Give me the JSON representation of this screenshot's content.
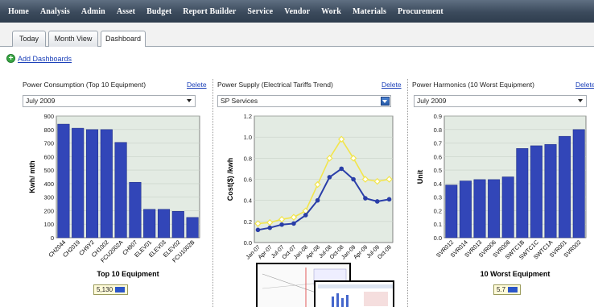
{
  "nav": [
    "Home",
    "Analysis",
    "Admin",
    "Asset",
    "Budget",
    "Report Builder",
    "Service",
    "Vendor",
    "Work",
    "Materials",
    "Procurement"
  ],
  "tabs": [
    "Today",
    "Month View",
    "Dashboard"
  ],
  "add_dashboards": "Add Dashboards",
  "panels": [
    {
      "title": "Power Consumption (Top 10 Equipment)",
      "delete_label": "Delete",
      "select_value": "July 2009",
      "badge_value": "5,130"
    },
    {
      "title": "Power Supply (Electrical Tariffs Trend)",
      "delete_label": "Delete",
      "select_value": "SP Services"
    },
    {
      "title": "Power Harmonics (10 Worst Equipment)",
      "delete_label": "Delete",
      "select_value": "July 2009",
      "badge_value": "5.7"
    }
  ],
  "colors": {
    "bar": "#3246b8",
    "line_series": "#2a3ea8",
    "yellow_series": "#f2e54c",
    "plot_bg": "#e3ebe3",
    "nav_bg": "#3b4a5c"
  },
  "chart_data": [
    {
      "type": "bar",
      "title": "Power Consumption (Top 10 Equipment)",
      "xlabel": "Top 10 Equipment",
      "ylabel": "Kwh/ mth",
      "ylim": [
        0,
        900
      ],
      "yticks": [
        0,
        100,
        200,
        300,
        400,
        500,
        600,
        700,
        800,
        900
      ],
      "categories": [
        "CH2044",
        "CH2019",
        "CH9Y2",
        "CH1002",
        "FCU2002A",
        "CH907",
        "ELEV01",
        "ELEV03",
        "ELEV02",
        "FCU1002B"
      ],
      "values": [
        840,
        810,
        800,
        800,
        705,
        410,
        210,
        210,
        195,
        150
      ]
    },
    {
      "type": "line",
      "title": "Power Supply (Electrical Tariffs Trend)",
      "xlabel": "",
      "ylabel": "Cost($) /kwh",
      "ylim": [
        0,
        1.2
      ],
      "yticks": [
        0,
        0.2,
        0.4,
        0.6,
        0.8,
        1.0,
        1.2
      ],
      "ytick_labels": [
        "0.0",
        "0.2",
        "0.4",
        "0.6",
        "0.8",
        "1.0",
        "1.2"
      ],
      "x": [
        "Jan-07",
        "Apr-07",
        "Jul-07",
        "Oct-07",
        "Jan-08",
        "Apr-08",
        "Jul-08",
        "Oct-08",
        "Jan-09",
        "Apr-09",
        "Jul-09",
        "Oct-09"
      ],
      "series": [
        {
          "values": [
            0.18,
            0.19,
            0.22,
            0.24,
            0.3,
            0.55,
            0.8,
            0.98,
            0.8,
            0.6,
            0.58,
            0.6
          ]
        },
        {
          "values": [
            0.12,
            0.14,
            0.17,
            0.18,
            0.26,
            0.4,
            0.62,
            0.7,
            0.6,
            0.42,
            0.39,
            0.41
          ]
        }
      ]
    },
    {
      "type": "bar",
      "title": "Power Harmonics (10 Worst Equipment)",
      "xlabel": "10 Worst Equipment",
      "ylabel": "Unit",
      "ylim": [
        0,
        0.9
      ],
      "yticks": [
        0,
        0.1,
        0.2,
        0.3,
        0.4,
        0.5,
        0.6,
        0.7,
        0.8,
        0.9
      ],
      "ytick_labels": [
        "0.0",
        "0.1",
        "0.2",
        "0.3",
        "0.4",
        "0.5",
        "0.6",
        "0.7",
        "0.8",
        "0.9"
      ],
      "categories": [
        "SVR012",
        "SVR014",
        "SVR013",
        "SVR006",
        "SVR008",
        "SWTC1B",
        "SWTC1C",
        "SWTC1A",
        "SVR001",
        "SVR002"
      ],
      "values": [
        0.39,
        0.42,
        0.43,
        0.43,
        0.45,
        0.66,
        0.68,
        0.69,
        0.75,
        0.8
      ]
    }
  ]
}
